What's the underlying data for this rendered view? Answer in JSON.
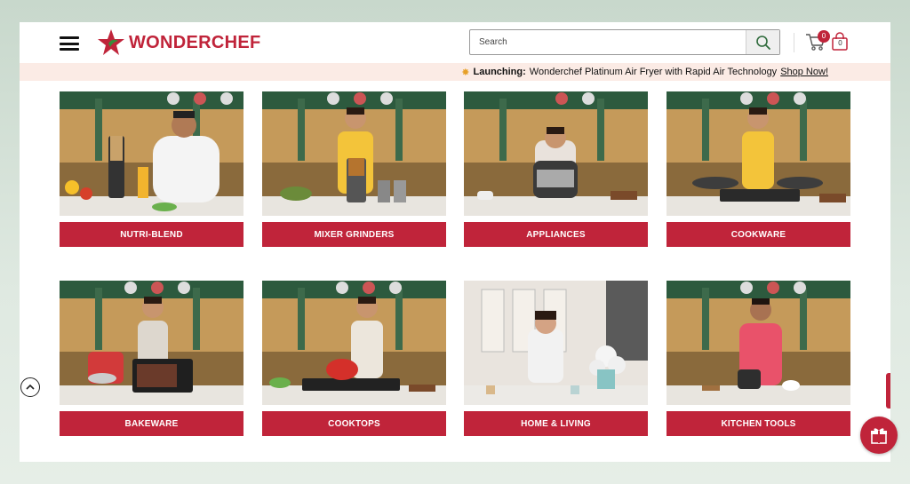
{
  "brand": {
    "name": "WONDERCHEF"
  },
  "search": {
    "placeholder": "Search"
  },
  "cart": {
    "count": "0"
  },
  "bag": {
    "count": "0"
  },
  "announcement": {
    "label": "Launching:",
    "text": "Wonderchef Platinum Air Fryer with Rapid Air Technology",
    "link": "Shop Now!"
  },
  "categories": [
    {
      "label": "NUTRI-BLEND"
    },
    {
      "label": "MIXER GRINDERS"
    },
    {
      "label": "APPLIANCES"
    },
    {
      "label": "COOKWARE"
    },
    {
      "label": "BAKEWARE"
    },
    {
      "label": "COOKTOPS"
    },
    {
      "label": "HOME & LIVING"
    },
    {
      "label": "KITCHEN TOOLS"
    }
  ],
  "colors": {
    "brand_red": "#c0243a",
    "announce_bg": "#fbebe5"
  },
  "icons": [
    "menu-icon",
    "logo-star-icon",
    "search-icon",
    "cart-icon",
    "bag-icon",
    "chevron-up-icon",
    "gift-icon"
  ]
}
